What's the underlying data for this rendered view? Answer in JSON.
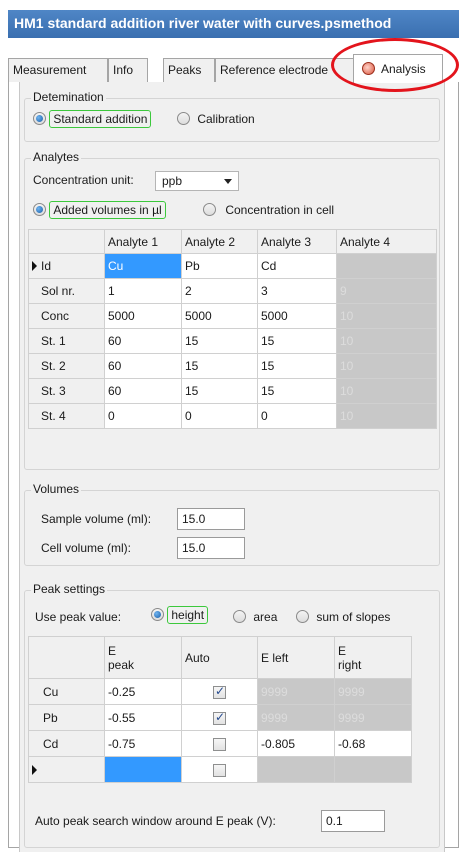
{
  "window": {
    "title": "HM1 standard addition river water with curves.psmethod"
  },
  "tabs": [
    {
      "label": "Measurement"
    },
    {
      "label": "Info"
    },
    {
      "label": "Peaks"
    },
    {
      "label": "Reference electrode"
    },
    {
      "label": "Analysis",
      "icon": "analysis-icon",
      "active": true
    }
  ],
  "determination": {
    "legend": "Detemination",
    "options": [
      {
        "label": "Standard addition",
        "checked": true
      },
      {
        "label": "Calibration",
        "checked": false
      }
    ]
  },
  "analytes": {
    "legend": "Analytes",
    "unit_label": "Concentration unit:",
    "unit_value": "ppb",
    "input_options": [
      {
        "label": "Added volumes in µl",
        "checked": true
      },
      {
        "label": "Concentration in cell",
        "checked": false
      }
    ],
    "columns": [
      "Analyte 1",
      "Analyte 2",
      "Analyte 3",
      "Analyte 4"
    ],
    "rows": [
      {
        "label": "Id",
        "cells": [
          "Cu",
          "Pb",
          "Cd",
          ""
        ]
      },
      {
        "label": "Sol nr.",
        "cells": [
          "1",
          "2",
          "3",
          "9"
        ]
      },
      {
        "label": "Conc",
        "cells": [
          "5000",
          "5000",
          "5000",
          "10"
        ]
      },
      {
        "label": "St. 1",
        "cells": [
          "60",
          "15",
          "15",
          "10"
        ]
      },
      {
        "label": "St. 2",
        "cells": [
          "60",
          "15",
          "15",
          "10"
        ]
      },
      {
        "label": "St. 3",
        "cells": [
          "60",
          "15",
          "15",
          "10"
        ]
      },
      {
        "label": "St. 4",
        "cells": [
          "0",
          "0",
          "0",
          "10"
        ]
      }
    ]
  },
  "volumes": {
    "legend": "Volumes",
    "sample_label": "Sample volume (ml):",
    "sample_value": "15.0",
    "cell_label": "Cell volume (ml):",
    "cell_value": "15.0"
  },
  "peak_settings": {
    "legend": "Peak settings",
    "use_label": "Use peak value:",
    "options": [
      {
        "label": "height",
        "checked": true
      },
      {
        "label": "area",
        "checked": false
      },
      {
        "label": "sum of slopes",
        "checked": false
      }
    ],
    "columns": [
      "E\npeak",
      "Auto",
      "E left",
      "E\nright"
    ],
    "rows": [
      {
        "label": "Cu",
        "e_peak": "-0.25",
        "auto": true,
        "e_left": "9999",
        "e_right": "9999"
      },
      {
        "label": "Pb",
        "e_peak": "-0.55",
        "auto": true,
        "e_left": "9999",
        "e_right": "9999"
      },
      {
        "label": "Cd",
        "e_peak": "-0.75",
        "auto": false,
        "e_left": "-0.805",
        "e_right": "-0.68"
      },
      {
        "label": "",
        "e_peak": "",
        "auto": false,
        "e_left": "",
        "e_right": ""
      }
    ],
    "window_label": "Auto peak search window around E peak (V):",
    "window_value": "0.1"
  }
}
